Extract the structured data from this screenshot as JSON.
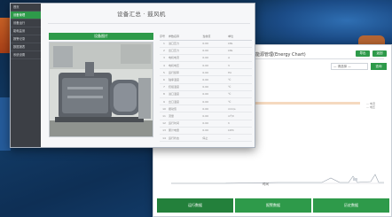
{
  "back_window": {
    "title": "能源管理(Energy Chart)",
    "header_buttons": [
      "导出",
      "返回"
    ],
    "select_value": "— 请选择 —",
    "select_button": "查询",
    "legend": [
      "— 电流",
      "— 电压"
    ],
    "axis_caption": "时间",
    "bottom_tabs": [
      "运行数据",
      "报警数据",
      "历史数据"
    ]
  },
  "front_window": {
    "title": "设备汇总 · 鼓风机",
    "sidebar_items": [
      "首页",
      "设备管理",
      "设备运行",
      "能耗监测",
      "报警记录",
      "数据报表",
      "系统设置"
    ],
    "section_button": "设备图片",
    "table": {
      "headers": [
        "序号",
        "参数名称",
        "当前值",
        "单位"
      ],
      "rows": [
        [
          "1",
          "进口压力",
          "0.00",
          "kPa"
        ],
        [
          "2",
          "出口压力",
          "0.00",
          "kPa"
        ],
        [
          "3",
          "电机电流",
          "0.00",
          "A"
        ],
        [
          "4",
          "电机电压",
          "0.00",
          "V"
        ],
        [
          "5",
          "运行频率",
          "0.00",
          "Hz"
        ],
        [
          "6",
          "轴承温度",
          "0.00",
          "℃"
        ],
        [
          "7",
          "绕组温度",
          "0.00",
          "℃"
        ],
        [
          "8",
          "进口温度",
          "0.00",
          "℃"
        ],
        [
          "9",
          "出口温度",
          "0.00",
          "℃"
        ],
        [
          "10",
          "振动值",
          "0.00",
          "mm/s"
        ],
        [
          "11",
          "流量",
          "0.00",
          "m³/h"
        ],
        [
          "12",
          "运行时间",
          "0.00",
          "h"
        ],
        [
          "13",
          "累计电量",
          "0.00",
          "kWh"
        ],
        [
          "14",
          "运行状态",
          "停止",
          "—"
        ]
      ]
    }
  }
}
